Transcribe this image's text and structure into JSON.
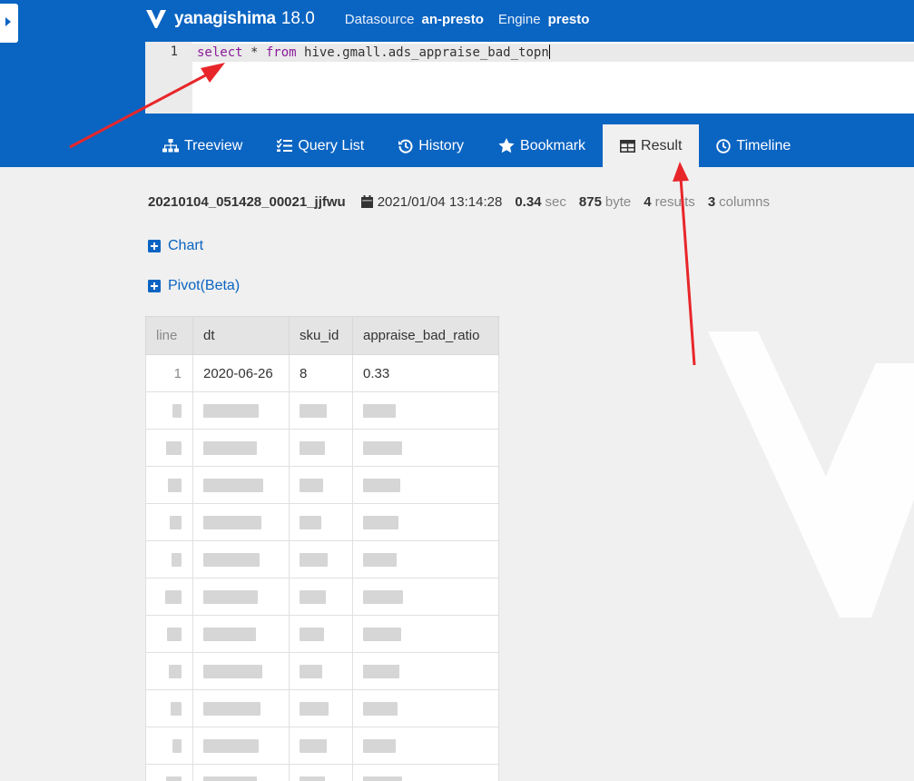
{
  "header": {
    "app_name": "yanagishima",
    "version": "18.0",
    "datasource_label": "Datasource",
    "datasource_value": "an-presto",
    "engine_label": "Engine",
    "engine_value": "presto"
  },
  "editor": {
    "line_number": "1",
    "query_keyword1": "select",
    "query_mid": " * ",
    "query_keyword2": "from",
    "query_rest": " hive.gmall.ads_appraise_bad_topn"
  },
  "tabs": [
    {
      "label": "Treeview",
      "icon": "sitemap-icon"
    },
    {
      "label": "Query List",
      "icon": "list-icon"
    },
    {
      "label": "History",
      "icon": "history-icon"
    },
    {
      "label": "Bookmark",
      "icon": "star-icon"
    },
    {
      "label": "Result",
      "icon": "table-icon",
      "active": true
    },
    {
      "label": "Timeline",
      "icon": "clock-icon"
    }
  ],
  "result_meta": {
    "query_id": "20210104_051428_00021_jjfwu",
    "datetime": "2021/01/04 13:14:28",
    "elapsed": "0.34",
    "elapsed_unit": "sec",
    "size": "875",
    "size_unit": "byte",
    "results": "4",
    "results_unit": "results",
    "columns": "3",
    "columns_unit": "columns"
  },
  "toggles": {
    "chart": "Chart",
    "pivot": "Pivot(Beta)"
  },
  "table": {
    "headers": [
      "line",
      "dt",
      "sku_id",
      "appraise_bad_ratio"
    ],
    "rows": [
      [
        "1",
        "2020-06-26",
        "8",
        "0.33"
      ]
    ]
  },
  "colors": {
    "header_bg": "#0a64c2",
    "arrow": "#e8262a"
  }
}
